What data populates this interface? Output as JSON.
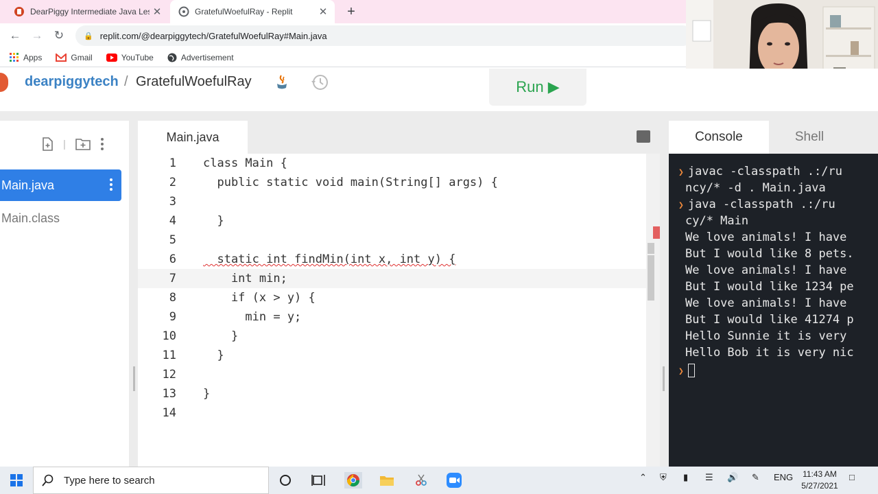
{
  "browser": {
    "tabs": [
      {
        "title": "DearPiggy Intermediate Java Less",
        "close": "✕"
      },
      {
        "title": "GratefulWoefulRay - Replit",
        "close": "✕"
      }
    ],
    "new_tab": "+",
    "url": "replit.com/@dearpiggytech/GratefulWoefulRay#Main.java",
    "bookmarks": [
      "Apps",
      "Gmail",
      "YouTube",
      "Advertisement"
    ]
  },
  "replit": {
    "owner": "dearpiggytech",
    "separator": "/",
    "repl_name": "GratefulWoefulRay",
    "run_label": "Run ▶"
  },
  "files": {
    "active": "Main.java",
    "other": "Main.class"
  },
  "editor": {
    "tab": "Main.java",
    "lines": [
      {
        "n": "1",
        "text": "class Main {"
      },
      {
        "n": "2",
        "text": "  public static void main(String[] args) {"
      },
      {
        "n": "3",
        "text": ""
      },
      {
        "n": "4",
        "text": "  }"
      },
      {
        "n": "5",
        "text": ""
      },
      {
        "n": "6",
        "text": "  static int findMin(int x, int y) {"
      },
      {
        "n": "7",
        "text": "    int min;"
      },
      {
        "n": "8",
        "text": "    if (x > y) {"
      },
      {
        "n": "9",
        "text": "      min = y;"
      },
      {
        "n": "10",
        "text": "    }"
      },
      {
        "n": "11",
        "text": "  }"
      },
      {
        "n": "12",
        "text": ""
      },
      {
        "n": "13",
        "text": "}"
      },
      {
        "n": "14",
        "text": ""
      }
    ]
  },
  "console": {
    "tabs": [
      "Console",
      "Shell"
    ],
    "lines": [
      {
        "prompt": true,
        "text": "javac -classpath .:/ru"
      },
      {
        "prompt": false,
        "text": "ncy/* -d . Main.java"
      },
      {
        "prompt": true,
        "text": "java -classpath .:/ru"
      },
      {
        "prompt": false,
        "text": "cy/* Main"
      },
      {
        "prompt": false,
        "text": "We love animals! I have "
      },
      {
        "prompt": false,
        "text": "But I would like 8 pets."
      },
      {
        "prompt": false,
        "text": "We love animals! I have "
      },
      {
        "prompt": false,
        "text": "But I would like 1234 pe"
      },
      {
        "prompt": false,
        "text": "We love animals! I have "
      },
      {
        "prompt": false,
        "text": "But I would like 41274 p"
      },
      {
        "prompt": false,
        "text": "Hello Sunnie it is very "
      },
      {
        "prompt": false,
        "text": "Hello Bob it is very nic"
      }
    ]
  },
  "taskbar": {
    "search_placeholder": "Type here to search",
    "language": "ENG",
    "time": "11:43 AM",
    "date": "5/27/2021"
  },
  "colors": {
    "accent": "#2f7fe6",
    "run_green": "#2aa44f",
    "owner_blue": "#3b82c4",
    "terminal_bg": "#1d2127",
    "tabstrip_pink": "#fce4f1"
  }
}
